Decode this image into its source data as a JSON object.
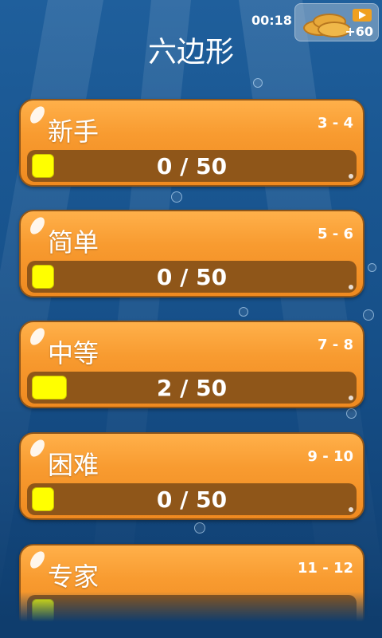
{
  "status": {
    "clock": "00:18"
  },
  "bonus": {
    "label": "+60"
  },
  "title": "六边形",
  "levels": [
    {
      "name": "新手",
      "range": "3 - 4",
      "progress_text": "0 / 50",
      "progress": 0
    },
    {
      "name": "简单",
      "range": "5 - 6",
      "progress_text": "0 / 50",
      "progress": 0
    },
    {
      "name": "中等",
      "range": "7 - 8",
      "progress_text": "2 / 50",
      "progress": 0.04
    },
    {
      "name": "困难",
      "range": "9 - 10",
      "progress_text": "0 / 50",
      "progress": 0
    },
    {
      "name": "专家",
      "range": "11 - 12",
      "progress_text": "",
      "progress": 0
    }
  ],
  "colors": {
    "card": "#f89b30",
    "bar": "#8f5619",
    "fill": "#ffff00",
    "background": "#1a5792"
  },
  "icons": {
    "bonus": [
      "coins-icon",
      "video-play-icon"
    ]
  }
}
